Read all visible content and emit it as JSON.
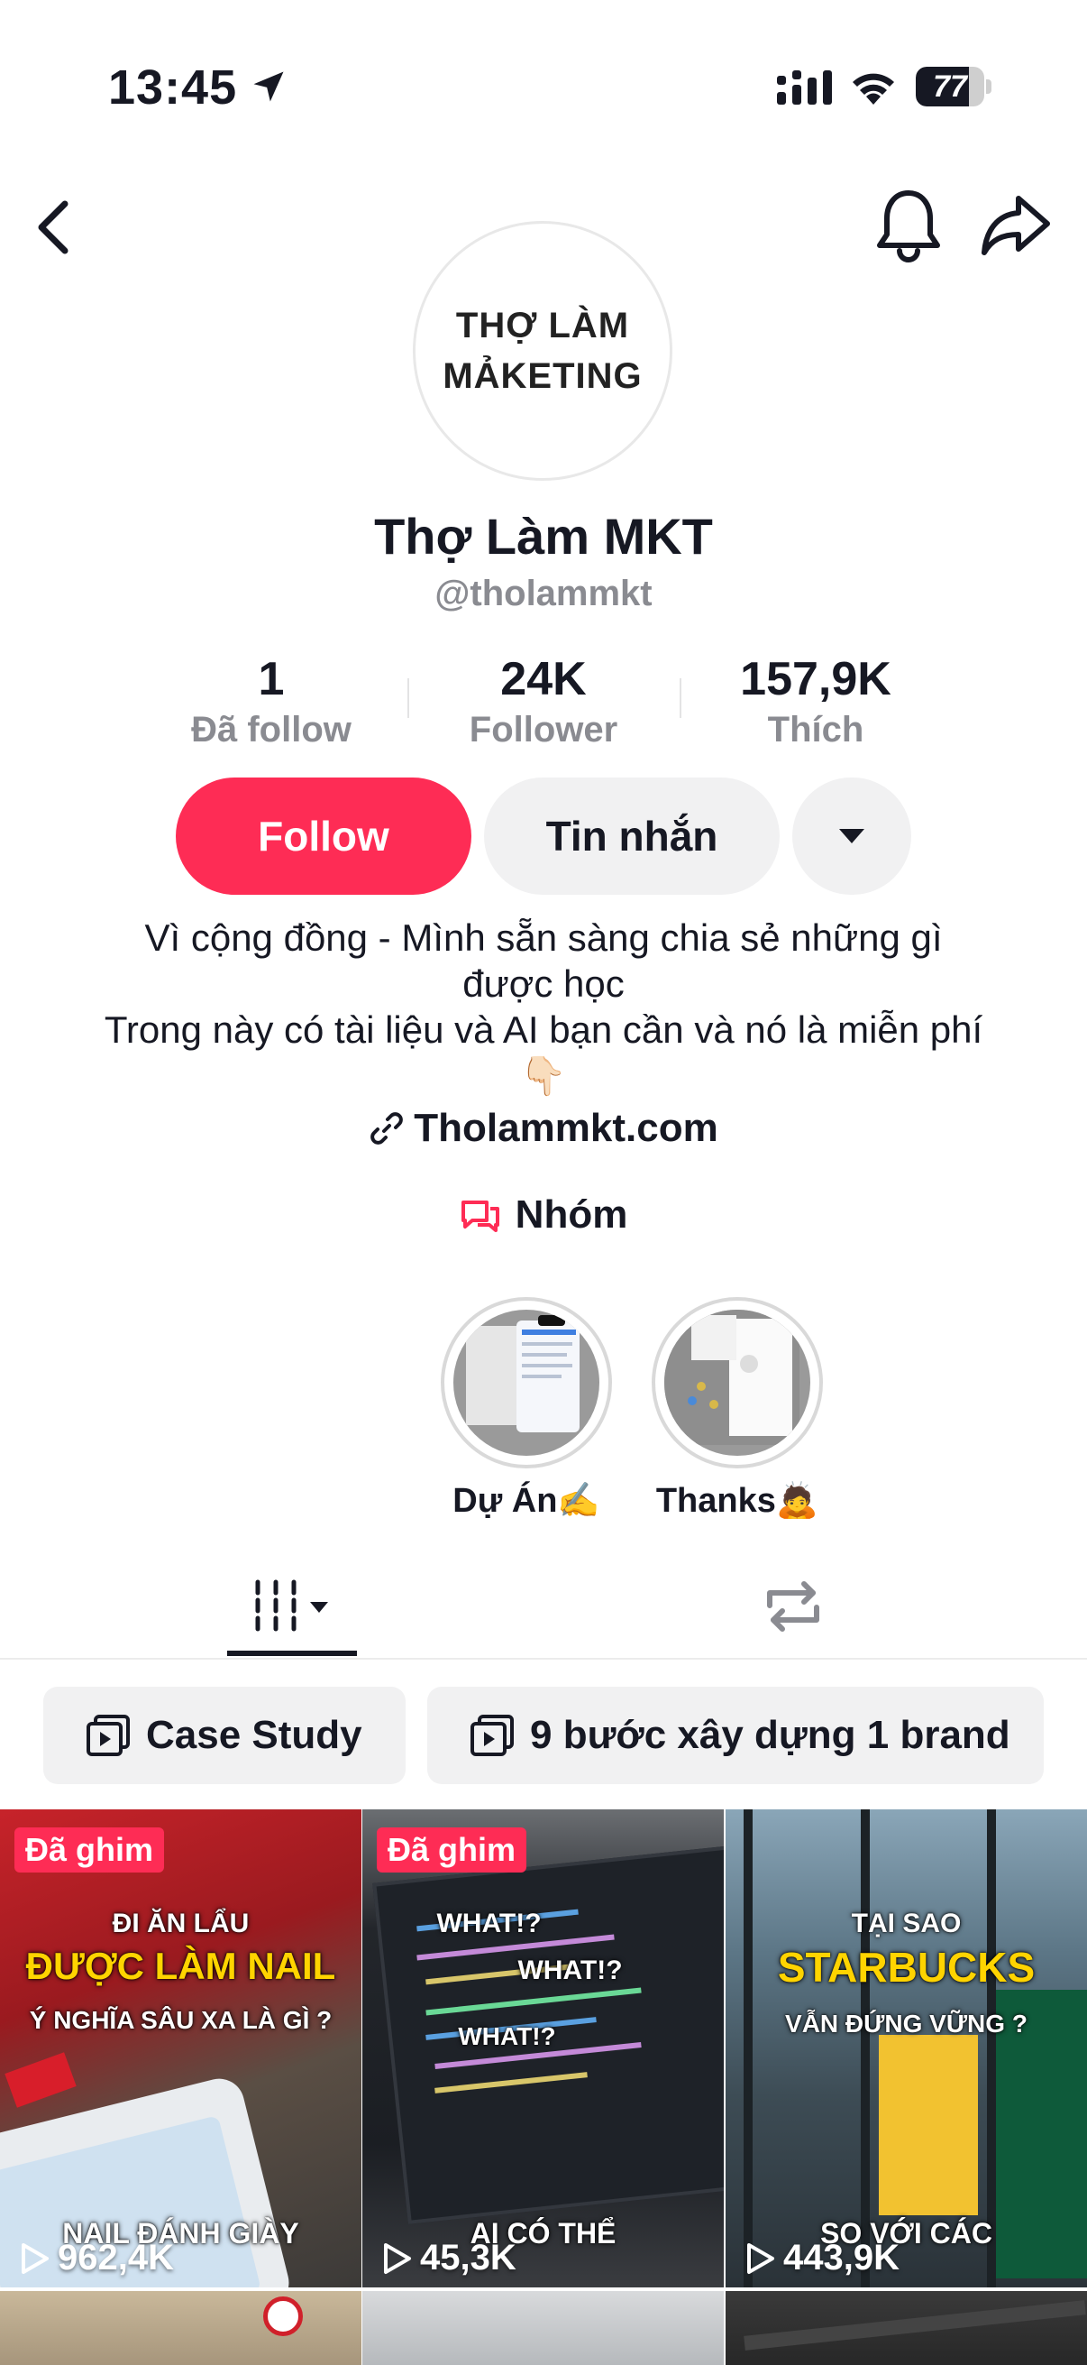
{
  "status_bar": {
    "time": "13:45",
    "battery": "77",
    "battery_level": 0.77
  },
  "profile": {
    "avatar_text": "THỢ LÀM\nMẢKETING",
    "display_name": "Thợ Làm MKT",
    "handle": "@tholammkt"
  },
  "stats": [
    {
      "value": "1",
      "label": "Đã follow"
    },
    {
      "value": "24K",
      "label": "Follower"
    },
    {
      "value": "157,9K",
      "label": "Thích"
    }
  ],
  "actions": {
    "follow": "Follow",
    "message": "Tin nhắn"
  },
  "bio": {
    "line1": "Vì cộng đồng - Mình sẵn sàng chia sẻ những gì được học",
    "line2": "Trong này có tài liệu và AI bạn cần và nó là miễn phí 👇🏻",
    "link": "Tholammkt.com",
    "group": "Nhóm"
  },
  "highlights": [
    {
      "label": "Dự Án✍️"
    },
    {
      "label": "Thanks🙇"
    }
  ],
  "playlists": [
    {
      "label": "Case Study"
    },
    {
      "label": "9 bước xây dựng 1 brand"
    }
  ],
  "videos": [
    {
      "pinned": "Đã ghim",
      "views": "962,4K",
      "cap_top": "ĐI ĂN LẨU",
      "cap_main": "ĐƯỢC LÀM NAIL",
      "cap_sub": "Ý NGHĨA SÂU XA LÀ GÌ ?",
      "cap_bottom": "NAIL ĐÁNH GIÀY"
    },
    {
      "pinned": "Đã ghim",
      "views": "45,3K",
      "cap_what": "WHAT!?",
      "cap_bottom": "AI CÓ THỂ"
    },
    {
      "views": "443,9K",
      "cap_top": "TẠI SAO",
      "cap_main": "STARBUCKS",
      "cap_sub": "VẪN ĐỨNG VỮNG ?",
      "cap_bottom": "SO VỚI CÁC"
    }
  ],
  "colors": {
    "accent": "#fe2c55",
    "text": "#161823",
    "muted": "#8a8b91",
    "chip_bg": "#f1f1f2"
  }
}
